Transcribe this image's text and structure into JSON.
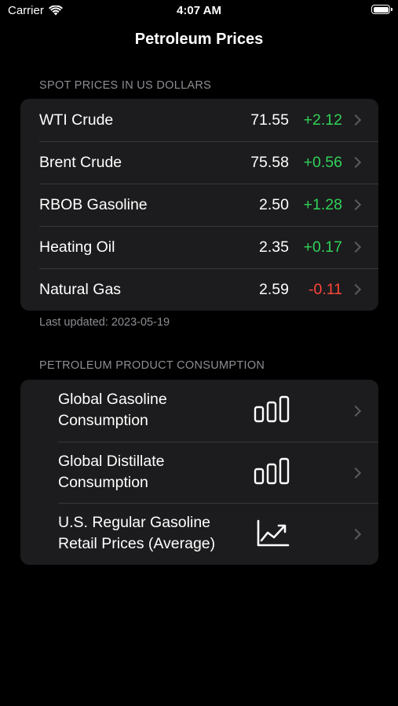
{
  "status_bar": {
    "carrier": "Carrier",
    "time": "4:07 AM"
  },
  "nav": {
    "title": "Petroleum Prices"
  },
  "spot": {
    "header": "SPOT PRICES IN US DOLLARS",
    "rows": [
      {
        "name": "WTI Crude",
        "price": "71.55",
        "change": "+2.12"
      },
      {
        "name": "Brent Crude",
        "price": "75.58",
        "change": "+0.56"
      },
      {
        "name": "RBOB Gasoline",
        "price": "2.50",
        "change": "+1.28"
      },
      {
        "name": "Heating Oil",
        "price": "2.35",
        "change": "+0.17"
      },
      {
        "name": "Natural Gas",
        "price": "2.59",
        "change": "-0.11"
      }
    ],
    "last_updated": "Last updated: 2023-05-19"
  },
  "consumption": {
    "header": "PETROLEUM PRODUCT CONSUMPTION",
    "rows": [
      {
        "label": "Global Gasoline Consumption",
        "icon": "bar-chart-icon"
      },
      {
        "label": "Global Distillate Consumption",
        "icon": "bar-chart-icon"
      },
      {
        "label": "U.S. Regular Gasoline Retail Prices (Average)",
        "icon": "line-chart-icon"
      }
    ]
  },
  "colors": {
    "background": "#000000",
    "card": "#1c1c1e",
    "positive": "#30d158",
    "negative": "#ff453a",
    "secondary_text": "#8d8d93"
  }
}
